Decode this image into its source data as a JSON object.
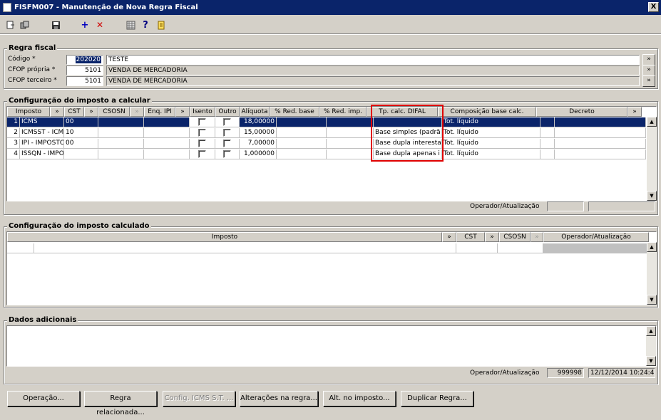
{
  "window": {
    "title": "FISFM007 - Manutenção de Nova Regra Fiscal",
    "close": "X"
  },
  "toolbar": {
    "icons": [
      "exit-icon",
      "copy-icon",
      "save-icon",
      "add-icon",
      "delete-icon",
      "calculator-icon",
      "help-icon",
      "notes-icon"
    ],
    "add": "+",
    "delete": "✕",
    "help": "?"
  },
  "regra": {
    "legend": "Regra fiscal",
    "codigo_label": "Código *",
    "codigo_value": "202020",
    "codigo_desc": "TESTE",
    "cfop_propria_label": "CFOP própria *",
    "cfop_propria_value": "5101",
    "cfop_propria_desc": "VENDA DE MERCADORIA",
    "cfop_terceiro_label": "CFOP terceiro *",
    "cfop_terceiro_value": "5101",
    "cfop_terceiro_desc": "VENDA DE MERCADORIA",
    "more": "»"
  },
  "config_calc": {
    "legend": "Configuração do imposto a calcular",
    "columns": [
      "Imposto",
      "»",
      "CST",
      "»",
      "CSOSN",
      "»",
      "Enq. IPI",
      "»",
      "Isento",
      "Outro",
      "Alíquota",
      "% Red. base",
      "% Red. imp.",
      "Tp. calc. DIFAL",
      "Composição base calc.",
      "Decreto",
      "»"
    ],
    "rows": [
      {
        "n": "1",
        "imposto": "ICMS",
        "cst": "00",
        "aliquota": "18,00000",
        "difal": "",
        "comp": "Tot. líquido"
      },
      {
        "n": "2",
        "imposto": "ICMSST - ICMS",
        "cst": "10",
        "aliquota": "15,00000",
        "difal": "Base simples (padrã",
        "comp": "Tot. líquido"
      },
      {
        "n": "3",
        "imposto": "IPI - IMPOSTO",
        "cst": "00",
        "aliquota": "7,00000",
        "difal": "Base dupla interesta",
        "comp": "Tot. líquido"
      },
      {
        "n": "4",
        "imposto": "ISSQN - IMPOS",
        "cst": "",
        "aliquota": "1,000000",
        "difal": "Base dupla apenas i",
        "comp": "Tot. líquido"
      }
    ],
    "operador_label": "Operador/Atualização"
  },
  "config_calculado": {
    "legend": "Configuração do imposto calculado",
    "columns": [
      "Imposto",
      "»",
      "CST",
      "»",
      "CSOSN",
      "»",
      "Operador/Atualização"
    ]
  },
  "adicionais": {
    "legend": "Dados adicionais",
    "operador_label": "Operador/Atualização",
    "operador": "999998",
    "data": "12/12/2014 10:24:41"
  },
  "buttons": {
    "operacao": "Operação...",
    "regra_relacionada": "Regra relacionada...",
    "config_icms": "Config. ICMS S.T. ...",
    "alteracoes": "Alterações na regra...",
    "alt_imposto": "Alt. no imposto...",
    "duplicar": "Duplicar Regra..."
  }
}
